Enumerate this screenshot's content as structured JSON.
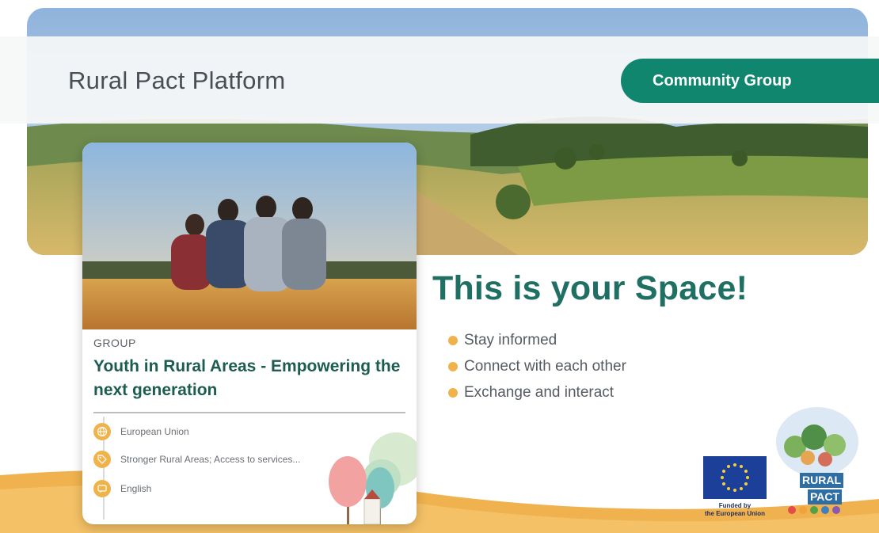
{
  "header": {
    "title": "Rural Pact Platform",
    "badge_label": "Community Group"
  },
  "group_card": {
    "kicker": "GROUP",
    "title": "Youth in Rural Areas - Empowering the next generation",
    "meta": [
      {
        "icon": "globe-icon",
        "text": "European Union"
      },
      {
        "icon": "tag-icon",
        "text": "Stronger Rural Areas; Access to services..."
      },
      {
        "icon": "language-icon",
        "text": "English"
      }
    ]
  },
  "hero": {
    "headline": "This is your Space!",
    "bullets": [
      "Stay informed",
      "Connect with each other",
      "Exchange and interact"
    ]
  },
  "logos": {
    "eu_caption_line1": "Funded by",
    "eu_caption_line2": "the European Union",
    "rural_pact_line1": "RURAL",
    "rural_pact_line2": "PACT"
  },
  "colors": {
    "accent_green": "#11866f",
    "headline_green": "#1f6f63",
    "bullet_orange": "#f0b34b",
    "eu_blue": "#1c3f9a"
  }
}
